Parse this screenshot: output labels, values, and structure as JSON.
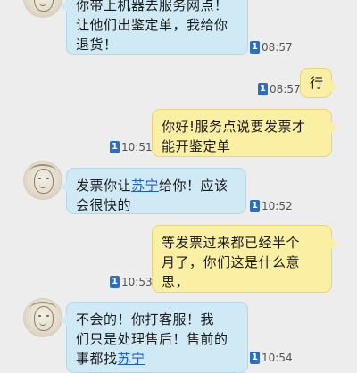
{
  "messages": [
    {
      "side": "left",
      "lines": [
        "你带上机器去服务网点！",
        "让他们出鉴定单，我给你",
        "退货！"
      ],
      "badge": "1",
      "time": "08:57"
    },
    {
      "side": "right",
      "lines": [
        "行"
      ],
      "badge": "1",
      "time": "08:57"
    },
    {
      "side": "right",
      "lines": [
        "你好!服务点说要发票才",
        "能开鉴定单"
      ],
      "badge": "1",
      "time": "10:51"
    },
    {
      "side": "left",
      "prefix": "发票你让",
      "link": "苏宁",
      "suffix": "给你！应该",
      "line2": "会很快的",
      "badge": "1",
      "time": "10:52"
    },
    {
      "side": "right",
      "lines": [
        "等发票过来都已经半个",
        "月了，你们这是什么意",
        "思，"
      ],
      "badge": "1",
      "time": "10:53"
    },
    {
      "side": "left",
      "lines": [
        "不会的！你打客服！我",
        "们只是处理售后！售前的"
      ],
      "prefix3": "事都找",
      "link3": "苏宁",
      "badge": "1",
      "time": "10:54"
    }
  ],
  "colors": {
    "incoming_bubble": "#cfe9f5",
    "outgoing_bubble": "#fbefa3",
    "link": "#1f5fbf",
    "badge": "#2a6fc4"
  }
}
